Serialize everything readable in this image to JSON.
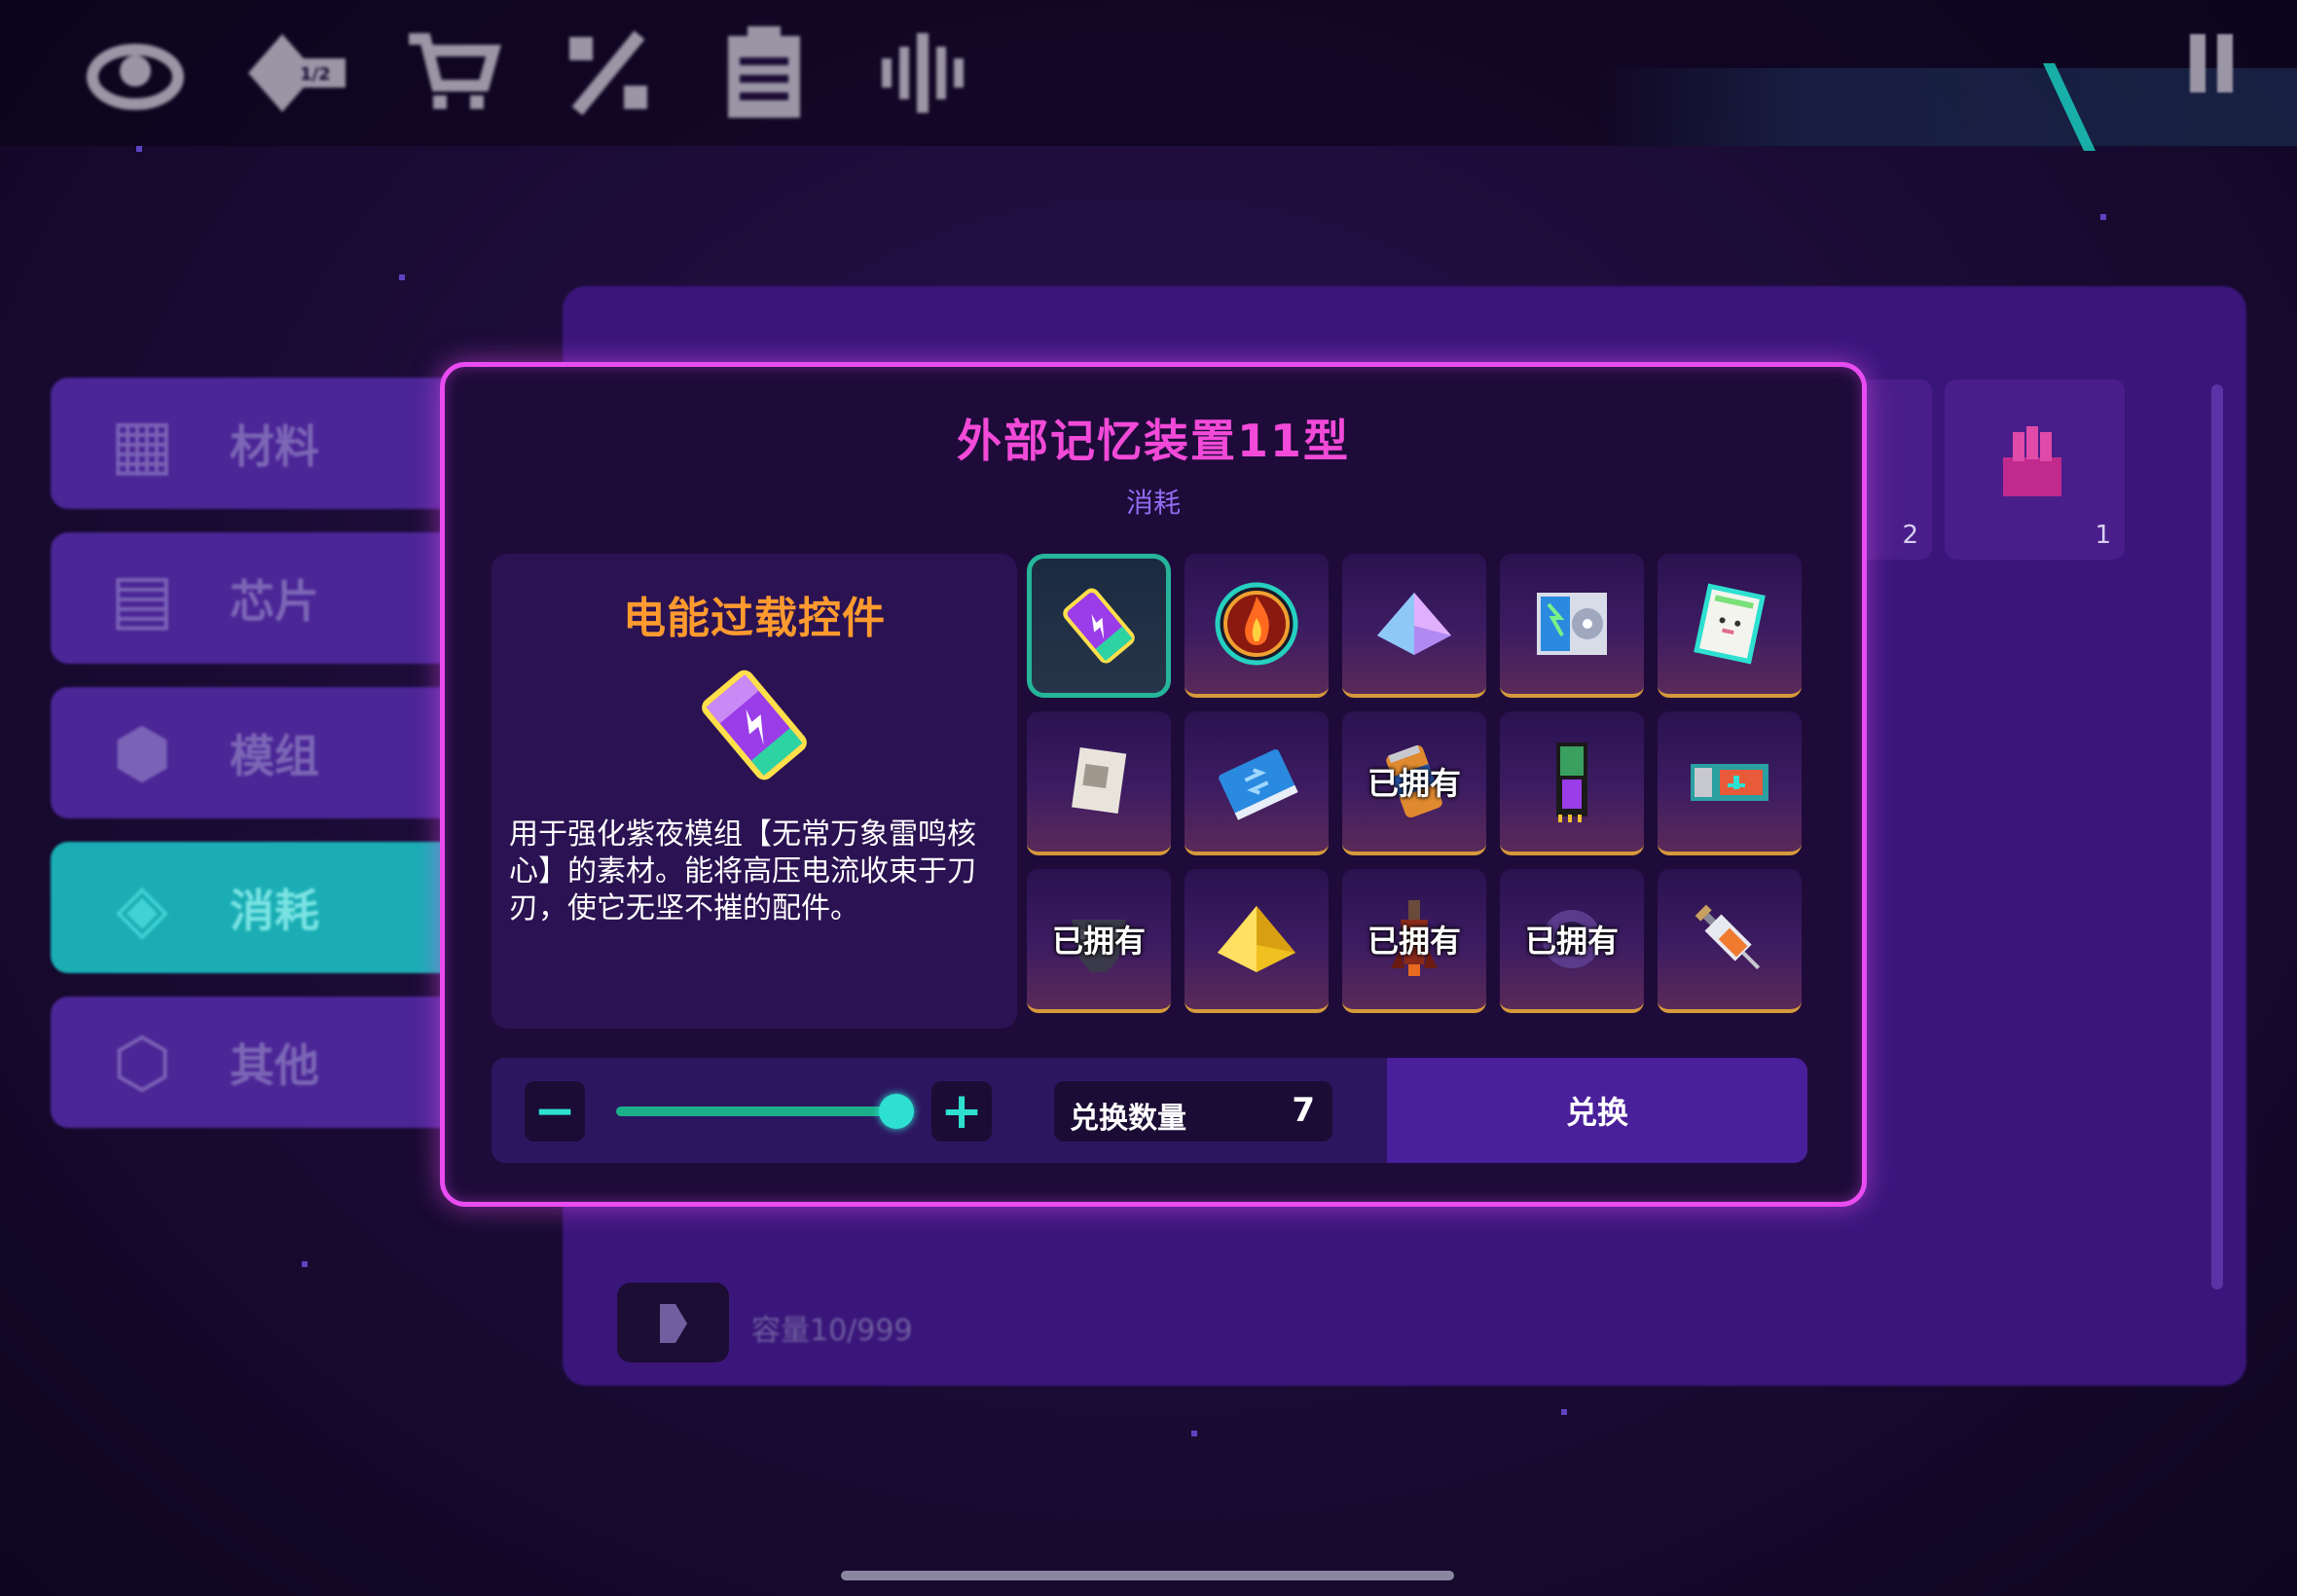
{
  "topbar": {
    "icons": [
      "cloud-icon",
      "badge-icon",
      "shop-cart-icon",
      "percent-icon",
      "clipboard-icon",
      "soundwave-icon"
    ],
    "badge_text": "1/2"
  },
  "sidebar": {
    "items": [
      {
        "label": "材料",
        "icon": "materials-icon",
        "active": false
      },
      {
        "label": "芯片",
        "icon": "chip-icon",
        "active": false
      },
      {
        "label": "模组",
        "icon": "module-icon",
        "active": false
      },
      {
        "label": "消耗",
        "icon": "consumable-icon",
        "active": true
      },
      {
        "label": "其他",
        "icon": "other-icon",
        "active": false
      }
    ]
  },
  "background": {
    "slot_counts": [
      "2",
      "1"
    ],
    "capacity": "容量10/999"
  },
  "modal": {
    "title": "外部记忆装置11型",
    "subtitle": "消耗",
    "detail": {
      "name": "电能过载控件",
      "description": "用于强化紫夜模组【无常万象雷鸣核心】的素材。能将高压电流收束于刀刃，使它无坚不摧的配件。"
    },
    "grid": [
      {
        "icon": "battery-icon",
        "owned": "",
        "selected": true
      },
      {
        "icon": "fire-orb-icon",
        "owned": ""
      },
      {
        "icon": "crystal-pyramid-icon",
        "owned": ""
      },
      {
        "icon": "disc-case-icon",
        "owned": ""
      },
      {
        "icon": "card-icon",
        "owned": ""
      },
      {
        "icon": "paper-icon",
        "owned": ""
      },
      {
        "icon": "blue-book-icon",
        "owned": ""
      },
      {
        "icon": "can-icon",
        "owned": "已拥有"
      },
      {
        "icon": "circuit-board-icon",
        "owned": ""
      },
      {
        "icon": "ticket-icon",
        "owned": ""
      },
      {
        "icon": "helmet-icon",
        "owned": "已拥有"
      },
      {
        "icon": "gold-pyramid-icon",
        "owned": ""
      },
      {
        "icon": "rocket-icon",
        "owned": "已拥有"
      },
      {
        "icon": "gear-orb-icon",
        "owned": "已拥有"
      },
      {
        "icon": "syringe-icon",
        "owned": ""
      }
    ],
    "controls": {
      "minus": "−",
      "plus": "+",
      "quantity_label": "兑换数量",
      "quantity_value": "7",
      "exchange_label": "兑换",
      "slider_level": 1.0
    }
  },
  "colors": {
    "accent_pink": "#e84cf0",
    "title_pink": "#f24ad8",
    "item_name_orange": "#ff9a2e",
    "teal": "#2ee0d0",
    "panel_purple": "#3a167a"
  }
}
